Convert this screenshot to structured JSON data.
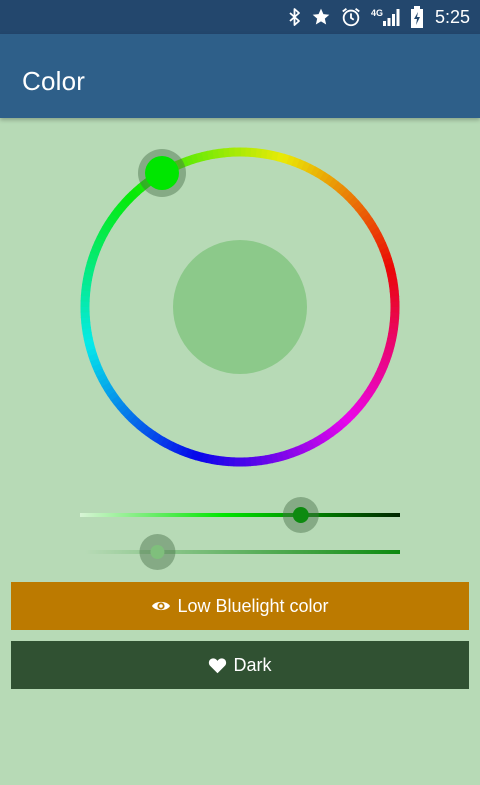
{
  "status_bar": {
    "time": "5:25",
    "icons": [
      "bluetooth-icon",
      "star-icon",
      "alarm-icon",
      "4g-signal-icon",
      "battery-charging-icon"
    ],
    "network_label": "4G"
  },
  "app_bar": {
    "title": "Color",
    "color": "#2e5f89"
  },
  "color_picker": {
    "selected_color": "#00e600",
    "preview_color": "#8cc98a",
    "hue_handle_color": "#00e600"
  },
  "sliders": {
    "saturation": {
      "value_fraction": 0.69,
      "track_start": "#d8f4d6",
      "track_end": "#002400"
    },
    "opacity": {
      "value_fraction": 0.23,
      "track_start": "#b7dab6",
      "track_end": "#0d8a10"
    }
  },
  "buttons": {
    "low_bluelight": {
      "label": "Low Bluelight color",
      "icon": "eye-icon",
      "color": "#bc7a00"
    },
    "dark": {
      "label": "Dark",
      "icon": "heart-icon",
      "color": "#305132"
    }
  },
  "background_color": "#b7dab6"
}
